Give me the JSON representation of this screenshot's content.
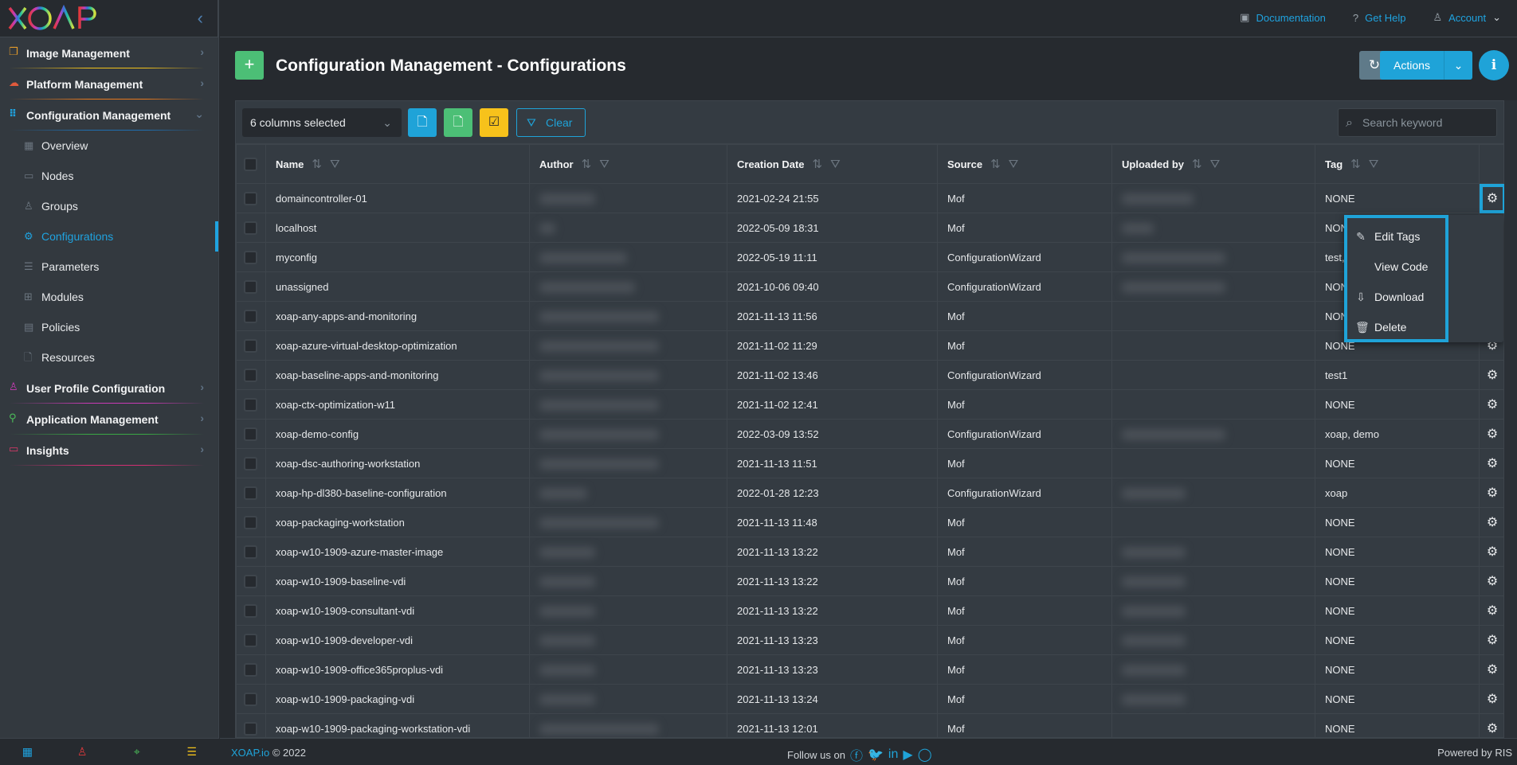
{
  "app": {
    "logo_text": "XOAP"
  },
  "sidebar": {
    "groups": [
      {
        "label": "Image Management",
        "icon": "copy-icon",
        "color": "#e39b2a",
        "underline": "#f2c21b"
      },
      {
        "label": "Platform Management",
        "icon": "cloud-icon",
        "color": "#e05a3c",
        "underline": "#e87a1e"
      },
      {
        "label": "Configuration Management",
        "icon": "grid-icon",
        "color": "#1fa3e0",
        "underline": "#1f6fb0",
        "expanded": true,
        "items": [
          {
            "label": "Overview",
            "icon": "layout-icon"
          },
          {
            "label": "Nodes",
            "icon": "laptop-icon"
          },
          {
            "label": "Groups",
            "icon": "users-icon"
          },
          {
            "label": "Configurations",
            "icon": "gear-icon",
            "active": true
          },
          {
            "label": "Parameters",
            "icon": "list-icon"
          },
          {
            "label": "Modules",
            "icon": "modules-icon"
          },
          {
            "label": "Policies",
            "icon": "policy-icon"
          },
          {
            "label": "Resources",
            "icon": "file-icon"
          }
        ]
      },
      {
        "label": "User Profile Configuration",
        "icon": "user-icon",
        "color": "#c93bb5",
        "underline": "#c93bb5"
      },
      {
        "label": "Application Management",
        "icon": "sitemap-icon",
        "color": "#4cbf5a",
        "underline": "#3aa845"
      },
      {
        "label": "Insights",
        "icon": "monitor-icon",
        "color": "#e0396a",
        "underline": "#d12f73"
      }
    ],
    "footer_icons": [
      {
        "name": "dashboard-icon",
        "color": "#1fa3e0"
      },
      {
        "name": "users-icon",
        "color": "#e0393c"
      },
      {
        "name": "location-icon",
        "color": "#4cbf5a"
      },
      {
        "name": "list-icon",
        "color": "#f2c21b"
      }
    ]
  },
  "topbar": {
    "documentation": "Documentation",
    "help": "Get Help",
    "account": "Account"
  },
  "page": {
    "title": "Configuration Management - Configurations",
    "add_label": "+",
    "actions_label": "Actions"
  },
  "toolbar": {
    "columns_selected": "6 columns selected",
    "clear_label": "Clear",
    "search_placeholder": "Search keyword"
  },
  "table": {
    "columns": [
      "Name",
      "Author",
      "Creation Date",
      "Source",
      "Uploaded by",
      "Tag"
    ],
    "rows": [
      {
        "name": "domaincontroller-01",
        "date": "2021-02-24 21:55",
        "source": "Mof",
        "tag": "NONE"
      },
      {
        "name": "localhost",
        "date": "2022-05-09 18:31",
        "source": "Mof",
        "tag": "NONE"
      },
      {
        "name": "myconfig",
        "date": "2022-05-19 11:11",
        "source": "ConfigurationWizard",
        "tag": "test,"
      },
      {
        "name": "unassigned",
        "date": "2021-10-06 09:40",
        "source": "ConfigurationWizard",
        "tag": "NONE"
      },
      {
        "name": "xoap-any-apps-and-monitoring",
        "date": "2021-11-13 11:56",
        "source": "Mof",
        "tag": "NONE"
      },
      {
        "name": "xoap-azure-virtual-desktop-optimization",
        "date": "2021-11-02 11:29",
        "source": "Mof",
        "tag": "NONE"
      },
      {
        "name": "xoap-baseline-apps-and-monitoring",
        "date": "2021-11-02 13:46",
        "source": "ConfigurationWizard",
        "tag": "test1"
      },
      {
        "name": "xoap-ctx-optimization-w11",
        "date": "2021-11-02 12:41",
        "source": "Mof",
        "tag": "NONE"
      },
      {
        "name": "xoap-demo-config",
        "date": "2022-03-09 13:52",
        "source": "ConfigurationWizard",
        "tag": "xoap, demo"
      },
      {
        "name": "xoap-dsc-authoring-workstation",
        "date": "2021-11-13 11:51",
        "source": "Mof",
        "tag": "NONE"
      },
      {
        "name": "xoap-hp-dl380-baseline-configuration",
        "date": "2022-01-28 12:23",
        "source": "ConfigurationWizard",
        "tag": "xoap"
      },
      {
        "name": "xoap-packaging-workstation",
        "date": "2021-11-13 11:48",
        "source": "Mof",
        "tag": "NONE"
      },
      {
        "name": "xoap-w10-1909-azure-master-image",
        "date": "2021-11-13 13:22",
        "source": "Mof",
        "tag": "NONE"
      },
      {
        "name": "xoap-w10-1909-baseline-vdi",
        "date": "2021-11-13 13:22",
        "source": "Mof",
        "tag": "NONE"
      },
      {
        "name": "xoap-w10-1909-consultant-vdi",
        "date": "2021-11-13 13:22",
        "source": "Mof",
        "tag": "NONE"
      },
      {
        "name": "xoap-w10-1909-developer-vdi",
        "date": "2021-11-13 13:23",
        "source": "Mof",
        "tag": "NONE"
      },
      {
        "name": "xoap-w10-1909-office365proplus-vdi",
        "date": "2021-11-13 13:23",
        "source": "Mof",
        "tag": "NONE"
      },
      {
        "name": "xoap-w10-1909-packaging-vdi",
        "date": "2021-11-13 13:24",
        "source": "Mof",
        "tag": "NONE"
      },
      {
        "name": "xoap-w10-1909-packaging-workstation-vdi",
        "date": "2021-11-13 12:01",
        "source": "Mof",
        "tag": "NONE"
      }
    ]
  },
  "row_menu": {
    "items": [
      {
        "label": "Edit Tags",
        "icon": "pencil-icon"
      },
      {
        "label": "View Code",
        "icon": "code-icon"
      },
      {
        "label": "Download",
        "icon": "cloud-download-icon"
      },
      {
        "label": "Delete",
        "icon": "trash-icon"
      }
    ]
  },
  "footer": {
    "brand": "XOAP.io",
    "copyright": "© 2022",
    "follow": "Follow us on",
    "powered": "Powered by RIS"
  },
  "colors": {
    "accent": "#1fa3d8",
    "success": "#4cbf76",
    "warning": "#f7c21b"
  }
}
